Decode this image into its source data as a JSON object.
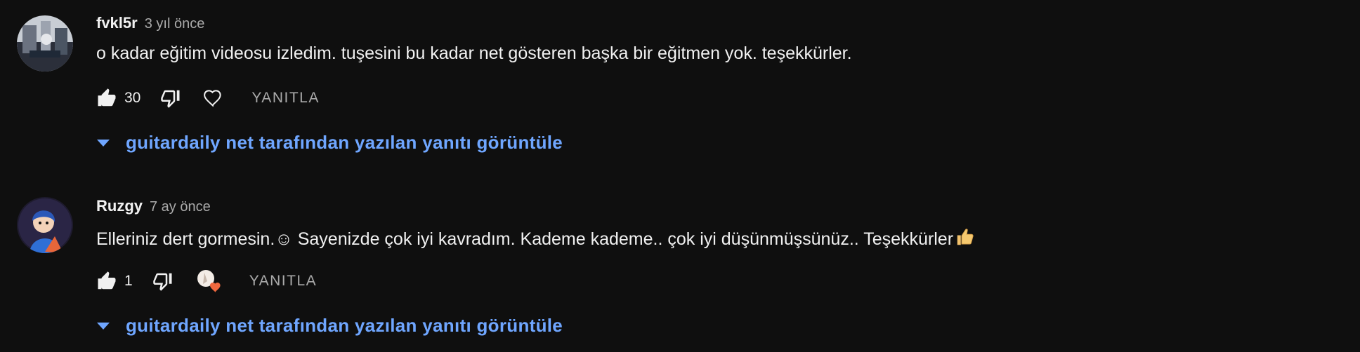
{
  "comments": [
    {
      "author": "fvkl5r",
      "time": "3 yıl önce",
      "text": "o kadar eğitim videosu izledim. tuşesini bu kadar net gösteren başka bir eğitmen yok. teşekkürler.",
      "likes": "30",
      "reply_label": "YANITLA",
      "view_replies_label": "guitardaily net tarafından yazılan yanıtı görüntüle"
    },
    {
      "author": "Ruzgy",
      "time": "7 ay önce",
      "text": "Elleriniz dert gormesin.☺ Sayenizde çok iyi kavradım. Kademe kademe.. çok iyi düşünmüşsünüz.. Teşekkürler",
      "likes": "1",
      "reply_label": "YANITLA",
      "view_replies_label": "guitardaily net tarafından yazılan yanıtı görüntüle"
    }
  ],
  "icons": {
    "like": "thumb-up-icon",
    "dislike": "thumb-down-icon",
    "heart": "heart-icon",
    "creator_heart": "creator-heart-icon",
    "expand": "caret-down-icon",
    "emoji": "thumbs-up-emoji-icon"
  },
  "colors": {
    "background": "#0f0f0f",
    "text": "#f1f1f1",
    "secondary": "#aaaaaa",
    "link": "#6fa6ff"
  }
}
